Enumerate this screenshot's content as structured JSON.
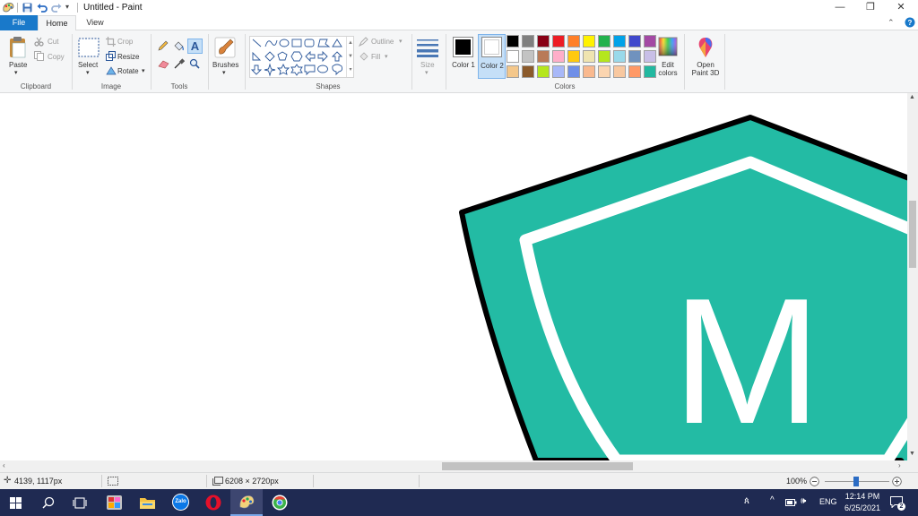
{
  "window": {
    "title": "Untitled - Paint",
    "controls": {
      "minimize": "—",
      "maximize": "❐",
      "close": "✕"
    }
  },
  "menu": {
    "file": "File",
    "home": "Home",
    "view": "View"
  },
  "ribbon": {
    "clipboard": {
      "label": "Clipboard",
      "paste": "Paste",
      "cut": "Cut",
      "copy": "Copy"
    },
    "image": {
      "label": "Image",
      "select": "Select",
      "crop": "Crop",
      "resize": "Resize",
      "rotate": "Rotate"
    },
    "tools": {
      "label": "Tools",
      "brushes": "Brushes"
    },
    "shapes": {
      "label": "Shapes",
      "outline": "Outline",
      "fill": "Fill"
    },
    "size": {
      "label": "Size"
    },
    "colors": {
      "label": "Colors",
      "color1_label": "Color 1",
      "color2_label": "Color 2",
      "color1": "#000000",
      "color2": "#ffffff",
      "edit_colors": "Edit colors",
      "open_paint3d": "Open Paint 3D",
      "palette_row1": [
        "#000000",
        "#7f7f7f",
        "#880015",
        "#ed1c24",
        "#ff7f27",
        "#fff200",
        "#22b14c",
        "#00a2e8",
        "#3f48cc",
        "#a349a4"
      ],
      "palette_row2": [
        "#ffffff",
        "#c3c3c3",
        "#b97a57",
        "#ffaec9",
        "#ffc90e",
        "#efe4b0",
        "#b5e61d",
        "#99d9ea",
        "#7092be",
        "#c8bfe7"
      ],
      "palette_row3": [
        "#f4c78a",
        "#8b5a2b",
        "#b5e61d",
        "#a8b8f8",
        "#6f8fe8",
        "#f9b98f",
        "#fbd5b0",
        "#f8c8a0",
        "#ff9966",
        "#22b8a0"
      ]
    }
  },
  "canvas": {
    "letter": "M",
    "shield_fill": "#23bba4",
    "shield_stroke": "#000000"
  },
  "status": {
    "cursor_pos": "4139, 1117px",
    "image_size": "6208 × 2720px",
    "zoom": "100%"
  },
  "taskbar": {
    "lang": "ENG",
    "time": "12:14 PM",
    "date": "6/25/2021",
    "notifications": "2",
    "zalo": "Zalo"
  }
}
